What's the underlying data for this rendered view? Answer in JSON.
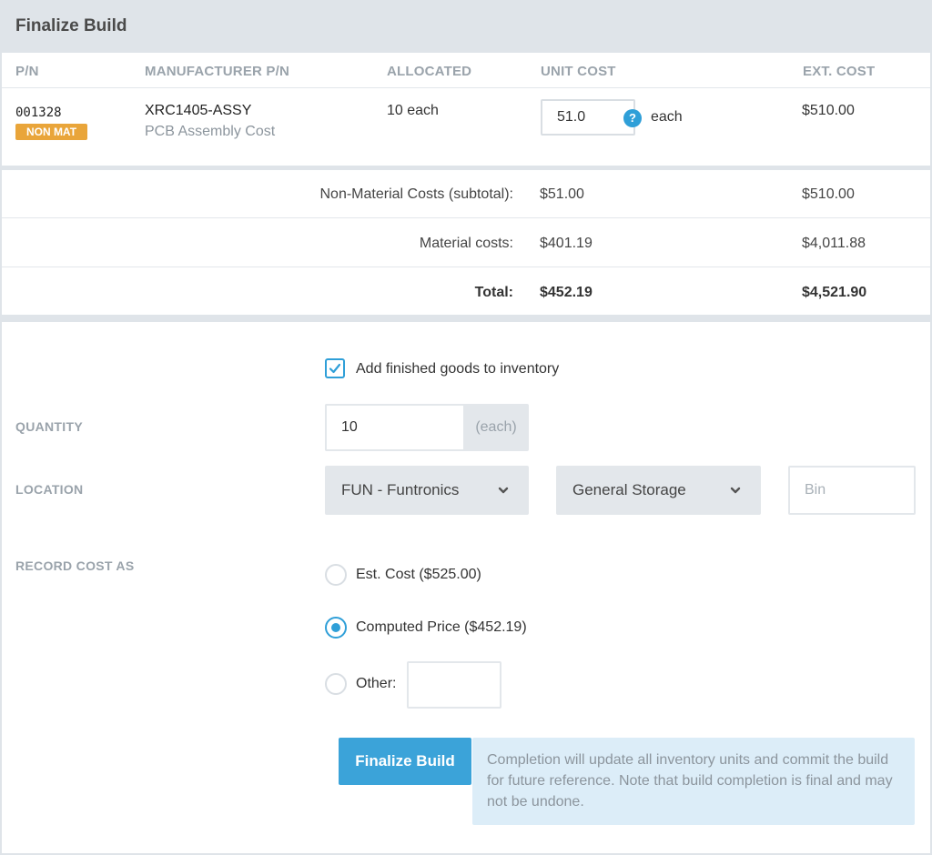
{
  "panel": {
    "title": "Finalize Build"
  },
  "table": {
    "headers": [
      "P/N",
      "MANUFACTURER P/N",
      "ALLOCATED",
      "UNIT COST",
      "EXT. COST"
    ],
    "row": {
      "pn": "001328",
      "badge": "NON MAT",
      "mpn": "XRC1405-ASSY",
      "description": "PCB Assembly Cost",
      "allocated": "10 each",
      "unit_cost_value": "51.0",
      "help_glyph": "?",
      "unit_suffix": "each",
      "ext_cost": "$510.00"
    }
  },
  "totals": [
    {
      "label": "Non-Material Costs (subtotal):",
      "unit": "$51.00",
      "ext": "$510.00"
    },
    {
      "label": "Material costs:",
      "unit": "$401.19",
      "ext": "$4,011.88"
    },
    {
      "label": "Total:",
      "unit": "$452.19",
      "ext": "$4,521.90"
    }
  ],
  "form": {
    "add_inventory_label": "Add finished goods to inventory",
    "add_inventory_checked": true,
    "quantity_label": "QUANTITY",
    "quantity_value": "10",
    "quantity_unit": "(each)",
    "location_label": "LOCATION",
    "location_site": "FUN - Funtronics",
    "location_storage": "General Storage",
    "bin_placeholder": "Bin",
    "record_cost_label": "RECORD COST AS",
    "options": [
      {
        "label": "Est. Cost ($525.00)",
        "selected": false
      },
      {
        "label": "Computed Price ($452.19)",
        "selected": true
      },
      {
        "label": "Other:",
        "selected": false
      }
    ],
    "other_value": "",
    "finalize_label": "Finalize Build",
    "note": "Completion will update all inventory units and commit the build for future reference. Note that build completion is final and may not be undone."
  },
  "colors": {
    "accent": "#2f9fd8",
    "badge": "#e9a53a",
    "note_bg": "#dcedf8"
  }
}
